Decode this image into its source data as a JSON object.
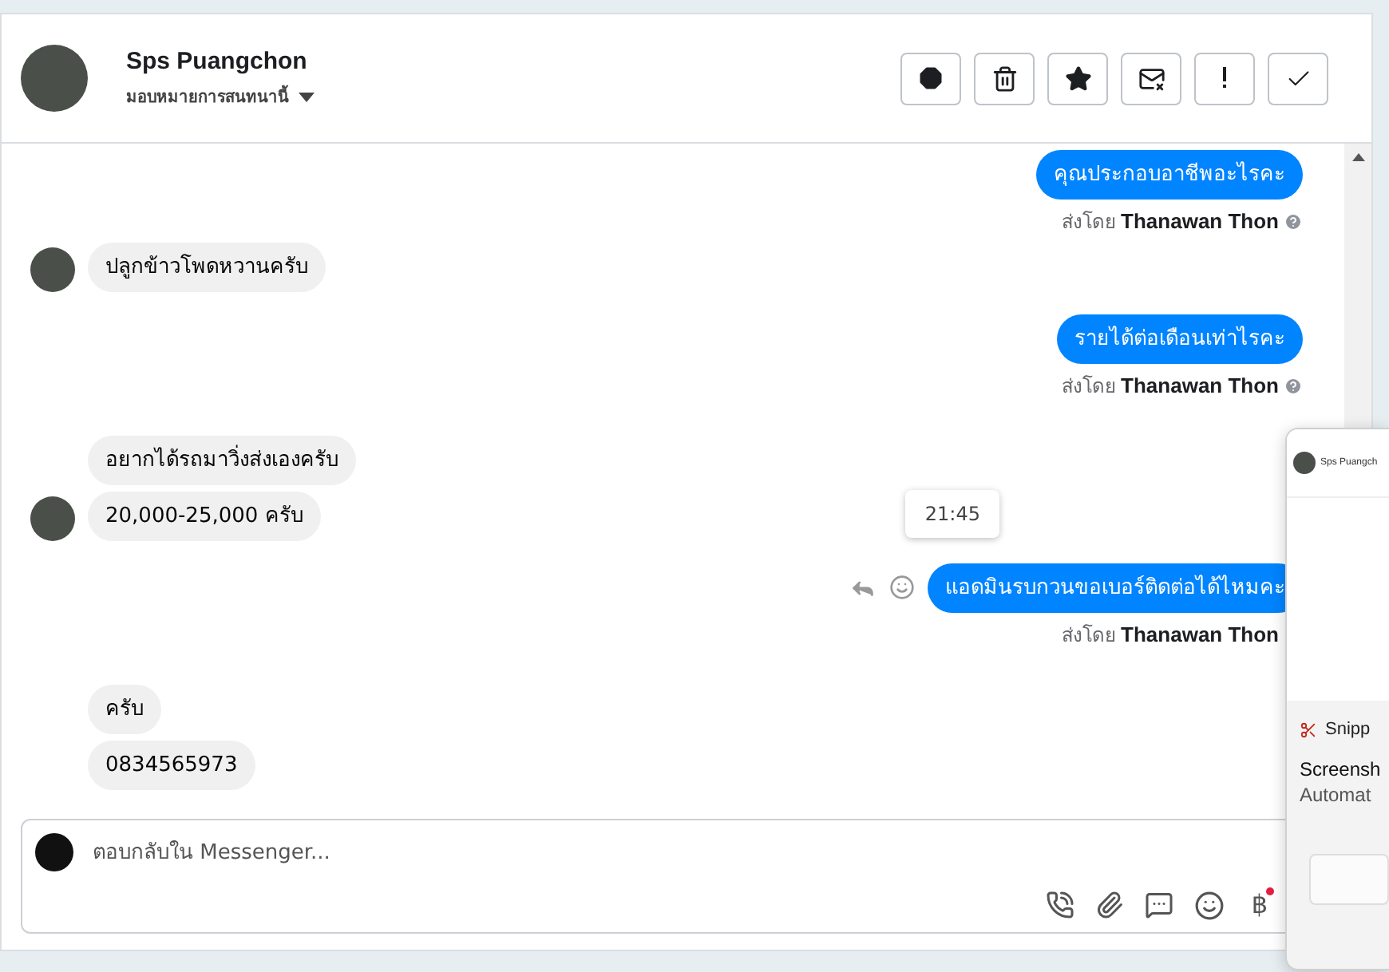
{
  "header": {
    "name": "Sps Puangchon",
    "assign_label": "มอบหมายการสนทนานี้"
  },
  "messages": [
    {
      "kind": "outgoing",
      "text": "คุณประกอบอาชีพอะไรคะ",
      "sent_by_label": "ส่งโดย",
      "sender": "Thanawan Thon"
    },
    {
      "kind": "incoming",
      "text": "ปลูกข้าวโพดหวานครับ",
      "avatar": true
    },
    {
      "kind": "outgoing",
      "text": "รายได้ต่อเดือนเท่าไรคะ",
      "sent_by_label": "ส่งโดย",
      "sender": "Thanawan Thon"
    },
    {
      "kind": "incoming",
      "text": "อยากได้รถมาวิ่งส่งเองครับ",
      "avatar": false
    },
    {
      "kind": "incoming",
      "text": "20,000-25,000 ครับ",
      "avatar": true
    },
    {
      "kind": "outgoing",
      "text": "แอดมินรบกวนขอเบอร์ติดต่อได้ไหมคะ",
      "time_tooltip": "21:45",
      "hovered": true,
      "sent_by_label": "ส่งโดย",
      "sender": "Thanawan Thon"
    },
    {
      "kind": "incoming",
      "text": "ครับ",
      "avatar": false
    },
    {
      "kind": "incoming",
      "text": "0834565973",
      "avatar": false
    }
  ],
  "composer": {
    "placeholder": "ตอบกลับใน Messenger...",
    "currency_symbol": "฿"
  },
  "notification": {
    "sender": "Sps Puangch",
    "app": "Snipp",
    "title": "Screensh",
    "body": "Automat"
  }
}
